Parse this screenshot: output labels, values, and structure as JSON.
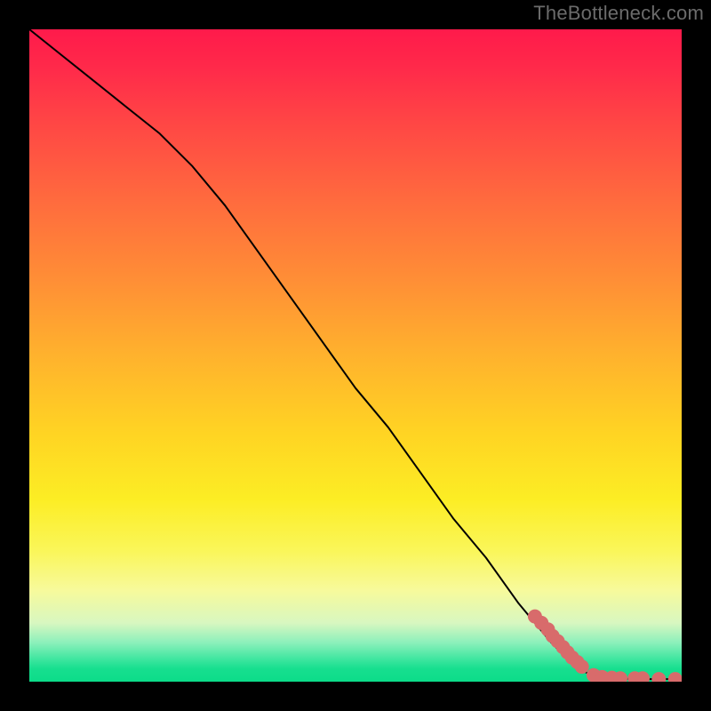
{
  "attribution": "TheBottleneck.com",
  "colors": {
    "frame_bg": "#000000",
    "attribution_text": "#6b6b6b",
    "curve": "#000000",
    "marker": "#d86b6b",
    "gradient_top": "#ff1a4b",
    "gradient_bottom": "#0cdc89"
  },
  "chart_data": {
    "type": "line",
    "title": "",
    "xlabel": "",
    "ylabel": "",
    "xlim": [
      0,
      100
    ],
    "ylim": [
      0,
      100
    ],
    "grid": false,
    "legend": false,
    "note": "Axes have no visible tick labels; values are read as percentage of plot area (x left→right, y bottom→top).",
    "series": [
      {
        "name": "bottleneck-curve",
        "type": "line",
        "x": [
          0,
          5,
          10,
          15,
          20,
          25,
          30,
          35,
          40,
          45,
          50,
          55,
          60,
          65,
          70,
          75,
          80,
          83,
          86,
          90,
          93,
          96,
          98,
          100
        ],
        "y": [
          100,
          96,
          92,
          88,
          84,
          79,
          73,
          66,
          59,
          52,
          45,
          39,
          32,
          25,
          19,
          12,
          6,
          3,
          1,
          0.5,
          0.4,
          0.4,
          0.4,
          0.4
        ]
      },
      {
        "name": "highlight-markers",
        "type": "scatter",
        "x": [
          77.5,
          78.5,
          79.5,
          80.2,
          81.0,
          81.8,
          82.5,
          83.2,
          84.0,
          84.7,
          86.5,
          87.8,
          89.3,
          90.6,
          92.8,
          94.0,
          96.5,
          99.0
        ],
        "y": [
          10.0,
          9.0,
          8.0,
          7.0,
          6.2,
          5.3,
          4.5,
          3.7,
          3.0,
          2.3,
          1.0,
          0.7,
          0.6,
          0.5,
          0.5,
          0.5,
          0.4,
          0.4
        ]
      }
    ]
  }
}
